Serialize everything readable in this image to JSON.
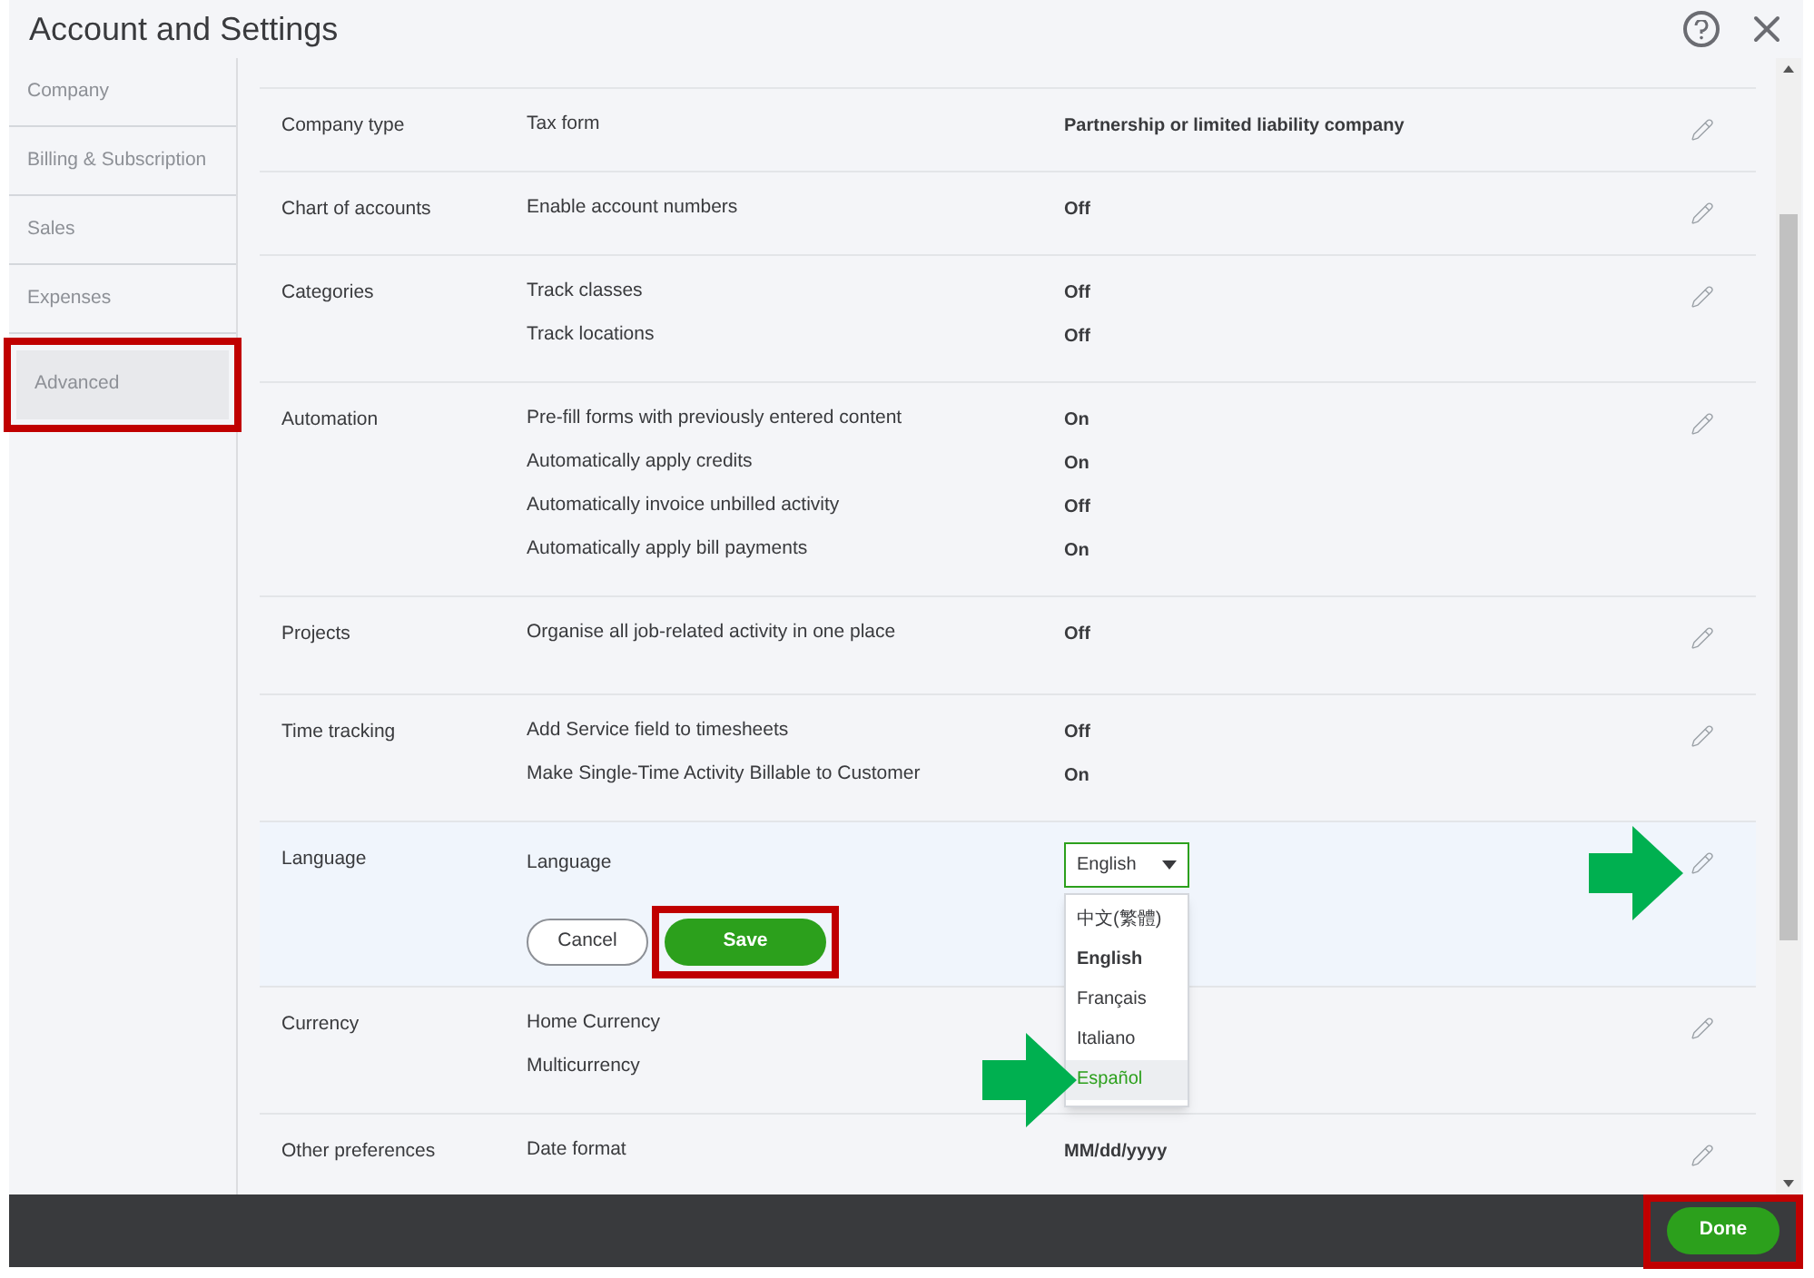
{
  "window": {
    "title": "Account and Settings"
  },
  "sidebar": {
    "items": [
      {
        "label": "Company",
        "selected": false,
        "highlighted": false
      },
      {
        "label": "Billing & Subscription",
        "selected": false,
        "highlighted": false
      },
      {
        "label": "Sales",
        "selected": false,
        "highlighted": false
      },
      {
        "label": "Expenses",
        "selected": false,
        "highlighted": false
      },
      {
        "label": "Advanced",
        "selected": true,
        "highlighted": true
      }
    ]
  },
  "sections": [
    {
      "kind": "view",
      "name": "Company type",
      "settings": [
        {
          "label": "Tax form",
          "value": "Partnership or limited liability company"
        }
      ]
    },
    {
      "kind": "view",
      "name": "Chart of accounts",
      "settings": [
        {
          "label": "Enable account numbers",
          "value": "Off"
        }
      ]
    },
    {
      "kind": "view",
      "name": "Categories",
      "settings": [
        {
          "label": "Track classes",
          "value": "Off"
        },
        {
          "label": "Track locations",
          "value": "Off"
        }
      ]
    },
    {
      "kind": "view",
      "name": "Automation",
      "settings": [
        {
          "label": "Pre-fill forms with previously entered content",
          "value": "On"
        },
        {
          "label": "Automatically apply credits",
          "value": "On"
        },
        {
          "label": "Automatically invoice unbilled activity",
          "value": "Off"
        },
        {
          "label": "Automatically apply bill payments",
          "value": "On"
        }
      ]
    },
    {
      "kind": "view",
      "name": "Projects",
      "settings": [
        {
          "label": "Organise all job-related activity in one place",
          "value": "Off"
        }
      ]
    },
    {
      "kind": "view",
      "name": "Time tracking",
      "settings": [
        {
          "label": "Add Service field to timesheets",
          "value": "Off"
        },
        {
          "label": "Make Single-Time Activity Billable to Customer",
          "value": "On"
        }
      ]
    },
    {
      "kind": "edit",
      "name": "Language",
      "arrow": true,
      "settings": [
        {
          "label": "Language",
          "value": "English"
        }
      ],
      "options": [
        {
          "label": "中文(繁體)",
          "current": false,
          "selected": false,
          "arrow": false
        },
        {
          "label": "English",
          "current": true,
          "selected": false,
          "arrow": false
        },
        {
          "label": "Français",
          "current": false,
          "selected": false,
          "arrow": false
        },
        {
          "label": "Italiano",
          "current": false,
          "selected": false,
          "arrow": false
        },
        {
          "label": "Español",
          "current": false,
          "selected": true,
          "arrow": true
        }
      ],
      "cancel": "Cancel",
      "save": {
        "label": "Save",
        "highlighted": true
      }
    },
    {
      "kind": "view",
      "name": "Currency",
      "settings": [
        {
          "label": "Home Currency"
        },
        {
          "label": "Multicurrency"
        }
      ]
    },
    {
      "kind": "view",
      "name": "Other preferences",
      "settings": [
        {
          "label": "Date format",
          "value": "MM/dd/yyyy"
        }
      ]
    }
  ],
  "footer": {
    "done": {
      "label": "Done",
      "highlighted": true
    }
  }
}
